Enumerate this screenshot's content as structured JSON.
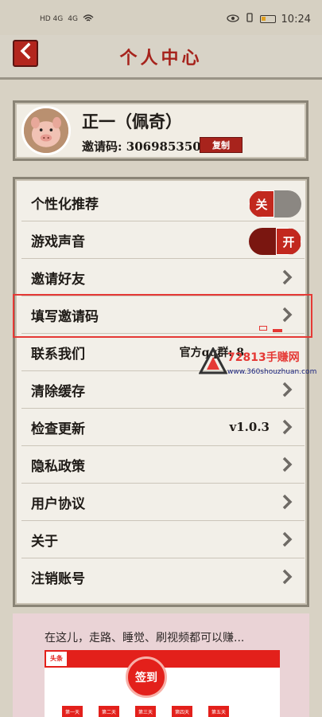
{
  "status_bar": {
    "signal_left": "HD 4G",
    "signal_right": "4G",
    "time": "10:24"
  },
  "header": {
    "title": "个人中心",
    "back_icon": "chevron-left-icon"
  },
  "profile": {
    "nickname": "正一（佩奇）",
    "invite_label": "邀请码: 306985350",
    "copy_label": "复制"
  },
  "settings": {
    "personalized": {
      "label": "个性化推荐",
      "toggle_label": "关",
      "state": "off"
    },
    "sound": {
      "label": "游戏声音",
      "toggle_label": "开",
      "state": "on"
    },
    "invite_friends": {
      "label": "邀请好友"
    },
    "fill_invite_code": {
      "label": "填写邀请码"
    },
    "contact": {
      "label": "联系我们",
      "value": "官方qq群: 8"
    },
    "clear_cache": {
      "label": "清除缓存"
    },
    "check_update": {
      "label": "检查更新",
      "value": "v1.0.3"
    },
    "privacy": {
      "label": "隐私政策"
    },
    "user_agreement": {
      "label": "用户协议"
    },
    "about": {
      "label": "关于"
    },
    "cancel_account": {
      "label": "注销账号"
    }
  },
  "watermark": {
    "title": "72813手赚网",
    "url": "www.360shouzhuan.com"
  },
  "promo": {
    "text": "在这儿，走路、睡觉、刷视频都可以赚...",
    "logo": "头条",
    "checkin": "签到",
    "days": [
      "第一天",
      "第二天",
      "第三天",
      "第四天",
      "第五天"
    ]
  },
  "colors": {
    "accent": "#a6231c",
    "highlight": "#e53935"
  }
}
